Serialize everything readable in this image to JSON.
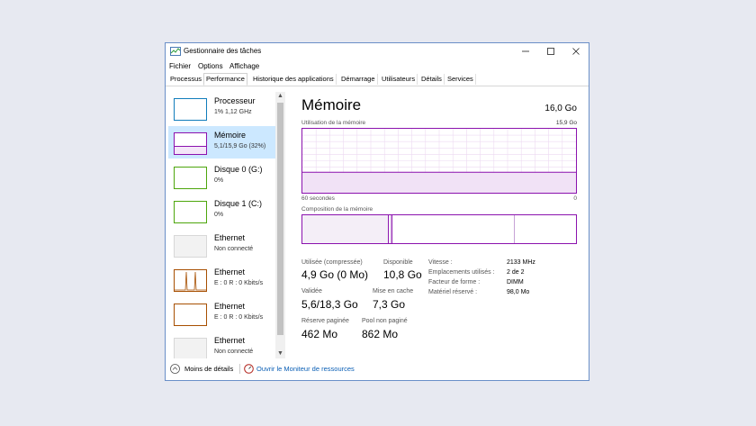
{
  "window": {
    "title": "Gestionnaire des tâches"
  },
  "menu": [
    "Fichier",
    "Options",
    "Affichage"
  ],
  "tabs": [
    "Processus",
    "Performance",
    "Historique des applications",
    "Démarrage",
    "Utilisateurs",
    "Détails",
    "Services"
  ],
  "active_tab": "Performance",
  "sidebar": [
    {
      "name": "Processeur",
      "sub": "1% 1,12 GHz",
      "color": "#117dbb"
    },
    {
      "name": "Mémoire",
      "sub": "5,1/15,9 Go (32%)",
      "color": "#8b12ae"
    },
    {
      "name": "Disque 0 (G:)",
      "sub": "0%",
      "color": "#4da60c"
    },
    {
      "name": "Disque 1 (C:)",
      "sub": "0%",
      "color": "#4da60c"
    },
    {
      "name": "Ethernet",
      "sub": "Non connecté",
      "color": "#b0b0b0"
    },
    {
      "name": "Ethernet",
      "sub": "E : 0 R : 0 Kbits/s",
      "color": "#a74f01"
    },
    {
      "name": "Ethernet",
      "sub": "E : 0 R : 0 Kbits/s",
      "color": "#a74f01"
    },
    {
      "name": "Ethernet",
      "sub": "Non connecté",
      "color": "#b0b0b0"
    }
  ],
  "main": {
    "title": "Mémoire",
    "total": "16,0 Go",
    "usage_label": "Utilisation de la mémoire",
    "usage_max": "15,9 Go",
    "axis_left": "60 secondes",
    "axis_right": "0",
    "composition_label": "Composition de la mémoire",
    "usage_fraction": 0.32
  },
  "stats": {
    "used_label": "Utilisée (compressée)",
    "used_value": "4,9 Go (0 Mo)",
    "available_label": "Disponible",
    "available_value": "10,8 Go",
    "committed_label": "Validée",
    "committed_value": "5,6/18,3 Go",
    "cached_label": "Mise en cache",
    "cached_value": "7,3 Go",
    "paged_label": "Réserve paginée",
    "paged_value": "462 Mo",
    "nonpaged_label": "Pool non paginé",
    "nonpaged_value": "862 Mo"
  },
  "details": [
    {
      "label": "Vitesse :",
      "value": "2133 MHz"
    },
    {
      "label": "Emplacements utilisés :",
      "value": "2 de 2"
    },
    {
      "label": "Facteur de forme :",
      "value": "DIMM"
    },
    {
      "label": "Matériel réservé :",
      "value": "98,0 Mo"
    }
  ],
  "footer": {
    "less_details": "Moins de détails",
    "resource_monitor": "Ouvrir le Moniteur de ressources"
  }
}
